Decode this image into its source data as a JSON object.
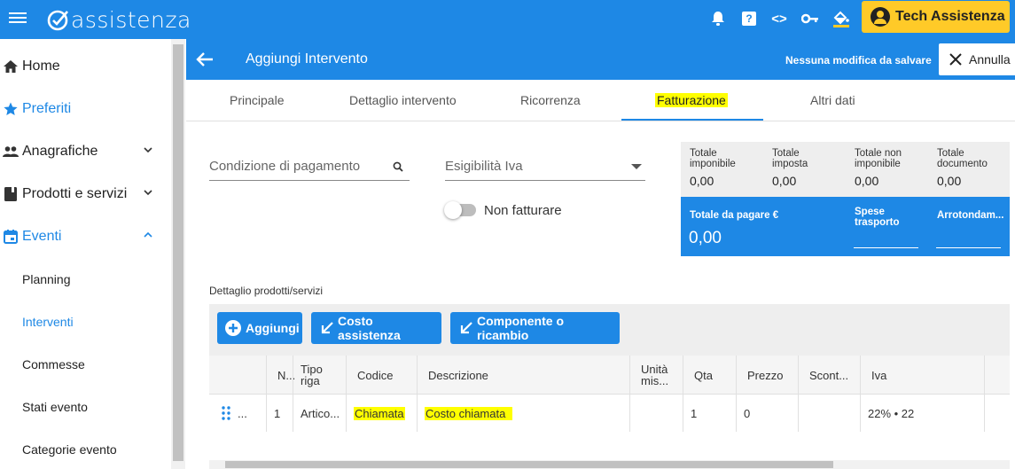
{
  "app": {
    "logo_text": "assistenza"
  },
  "topbar": {
    "icons": [
      "bell-icon",
      "help-icon",
      "code-icon",
      "key-icon",
      "paint-bucket-icon"
    ],
    "help_glyph": "?",
    "code_glyph": "<>",
    "user_name": "Tech Assistenza"
  },
  "sidebar": {
    "items": [
      {
        "label": "Home",
        "icon": "home-icon"
      },
      {
        "label": "Preferiti",
        "icon": "star-icon"
      },
      {
        "label": "Anagrafiche",
        "icon": "people-icon"
      },
      {
        "label": "Prodotti e servizi",
        "icon": "book-icon"
      },
      {
        "label": "Eventi",
        "icon": "calendar-icon"
      }
    ],
    "subitems": [
      "Planning",
      "Interventi",
      "Commesse",
      "Stati evento",
      "Categorie evento"
    ]
  },
  "header": {
    "title": "Aggiungi Intervento",
    "status": "Nessuna modifica da salvare",
    "cancel_label": "Annulla"
  },
  "tabs": [
    "Principale",
    "Dettaglio intervento",
    "Ricorrenza",
    "Fatturazione",
    "Altri dati"
  ],
  "form": {
    "payment_placeholder": "Condizione di pagamento",
    "vat_placeholder": "Esigibilità Iva",
    "no_invoice_label": "Non fatturare"
  },
  "totals": {
    "imponibile_label": "Totale imponibile",
    "imponibile_value": "0,00",
    "imposta_label": "Totale imposta",
    "imposta_value": "0,00",
    "non_imponibile_label": "Totale non imponibile",
    "non_imponibile_value": "0,00",
    "documento_label": "Totale documento",
    "documento_value": "0,00",
    "da_pagare_label": "Totale da pagare €",
    "da_pagare_value": "0,00",
    "spese_label": "Spese trasporto",
    "arrotondamento_label": "Arrotondam..."
  },
  "details": {
    "section_label": "Dettaglio prodotti/servizi",
    "add_label": "Aggiungi",
    "cost_label": "Costo assistenza",
    "component_label": "Componente o ricambio",
    "columns": [
      "N...",
      "Tipo riga",
      "Codice",
      "Descrizione",
      "Unità mis...",
      "Qta",
      "Prezzo",
      "Scont...",
      "Iva"
    ],
    "row": {
      "handle": "...",
      "n": "1",
      "tipo": "Artico...",
      "codice": "Chiamata",
      "descrizione": "Costo chiamata",
      "unita": "",
      "qta": "1",
      "prezzo": "0",
      "sconto": "",
      "iva": "22% • 22"
    }
  },
  "colors": {
    "primary": "#1e88e5",
    "accent": "#ffca28",
    "highlight": "#ffff00"
  }
}
